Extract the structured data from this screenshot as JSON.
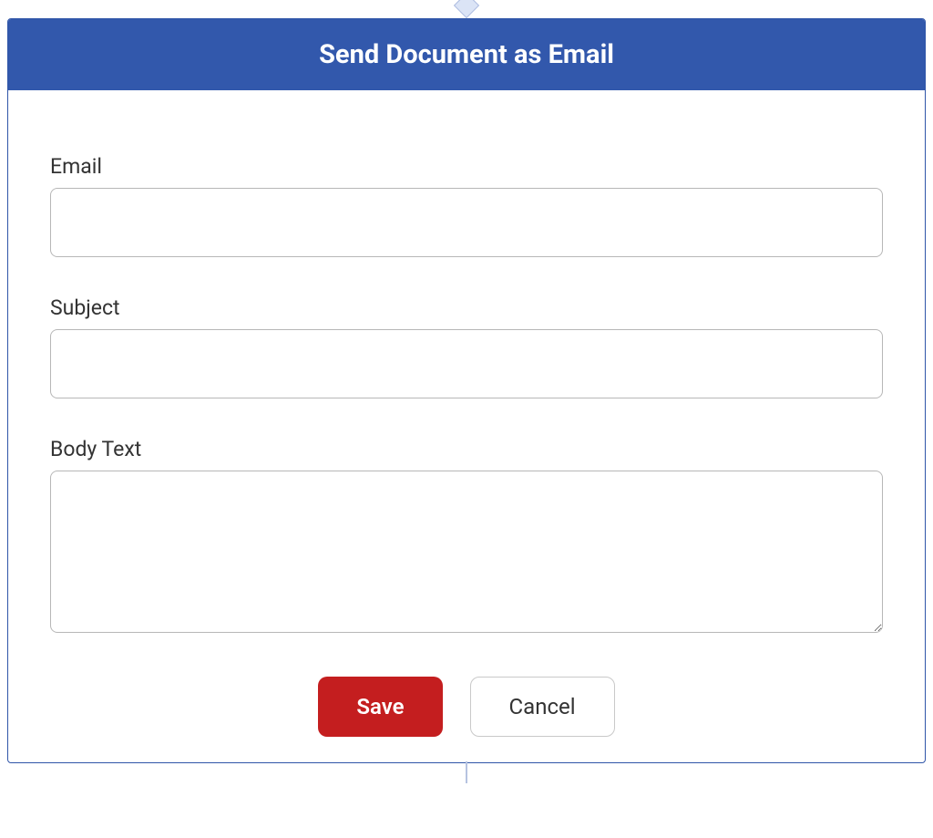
{
  "header": {
    "title": "Send Document as Email"
  },
  "form": {
    "email": {
      "label": "Email",
      "value": ""
    },
    "subject": {
      "label": "Subject",
      "value": ""
    },
    "body": {
      "label": "Body Text",
      "value": ""
    }
  },
  "buttons": {
    "save_label": "Save",
    "cancel_label": "Cancel"
  }
}
